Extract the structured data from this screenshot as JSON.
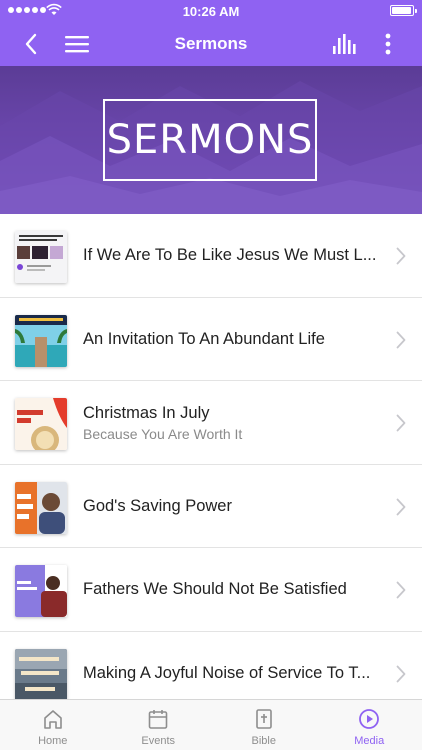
{
  "status_bar": {
    "time": "10:26 AM"
  },
  "nav": {
    "title": "Sermons"
  },
  "hero": {
    "banner_text": "SERMONS"
  },
  "sermons": [
    {
      "title": "If We Are To Be Like Jesus We Must L...",
      "subtitle": ""
    },
    {
      "title": "An Invitation To An Abundant Life",
      "subtitle": ""
    },
    {
      "title": "Christmas In July",
      "subtitle": "Because You Are Worth It"
    },
    {
      "title": "God's Saving Power",
      "subtitle": ""
    },
    {
      "title": "Fathers We Should Not Be Satisfied",
      "subtitle": ""
    },
    {
      "title": "Making A Joyful Noise of Service To T...",
      "subtitle": ""
    }
  ],
  "tabs": [
    {
      "label": "Home",
      "icon": "home-icon"
    },
    {
      "label": "Events",
      "icon": "calendar-icon"
    },
    {
      "label": "Bible",
      "icon": "bible-icon"
    },
    {
      "label": "Media",
      "icon": "play-circle-icon",
      "active": true
    }
  ],
  "colors": {
    "accent": "#8f62f2",
    "hero_bg": "#6d48b0",
    "tab_inactive": "#8e8e8e"
  }
}
